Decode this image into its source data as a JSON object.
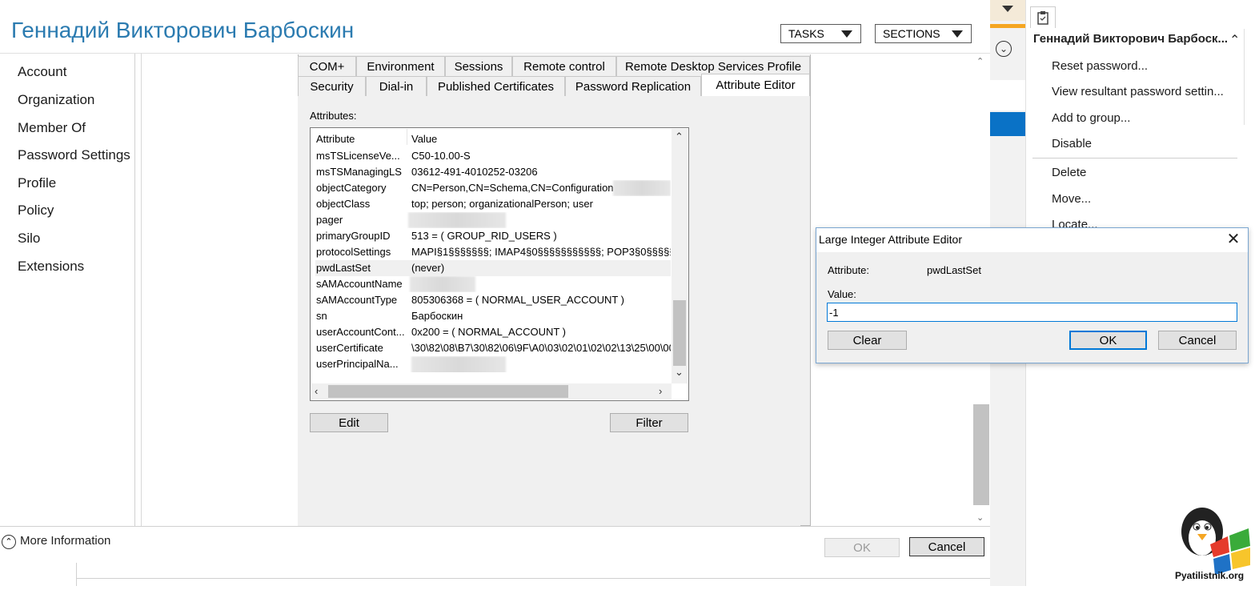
{
  "window": {
    "user_title": "Геннадий Викторович Барбоскин",
    "tasks_label": "TASKS",
    "sections_label": "SECTIONS"
  },
  "nav": {
    "items": [
      {
        "label": "Account"
      },
      {
        "label": "Organization"
      },
      {
        "label": "Member Of"
      },
      {
        "label": "Password Settings"
      },
      {
        "label": "Profile"
      },
      {
        "label": "Policy"
      },
      {
        "label": "Silo"
      },
      {
        "label": "Extensions"
      }
    ]
  },
  "properties": {
    "tabs_row1": [
      "COM+",
      "Environment",
      "Sessions",
      "Remote control",
      "Remote Desktop Services Profile"
    ],
    "tabs_row2": [
      "Security",
      "Dial-in",
      "Published Certificates",
      "Password Replication",
      "Attribute Editor"
    ],
    "active_tab": "Attribute Editor",
    "attributes_label": "Attributes:",
    "columns": {
      "attribute": "Attribute",
      "value": "Value"
    },
    "rows": [
      {
        "name": "msTSLicenseVe...",
        "value": "C50-10.00-S"
      },
      {
        "name": "msTSManagingLS",
        "value": "03612-491-4010252-03206"
      },
      {
        "name": "objectCategory",
        "value": "CN=Person,CN=Schema,CN=Configuration"
      },
      {
        "name": "objectClass",
        "value": "top; person; organizationalPerson; user"
      },
      {
        "name": "pager",
        "value": ""
      },
      {
        "name": "primaryGroupID",
        "value": "513 = ( GROUP_RID_USERS )"
      },
      {
        "name": "protocolSettings",
        "value": "MAPI§1§§§§§§§; IMAP4§0§§§§§§§§§§§; POP3§0§§§§§§"
      },
      {
        "name": "pwdLastSet",
        "value": "(never)"
      },
      {
        "name": "sAMAccountName",
        "value": ""
      },
      {
        "name": "sAMAccountType",
        "value": "805306368 = ( NORMAL_USER_ACCOUNT )"
      },
      {
        "name": "sn",
        "value": "Барбоскин"
      },
      {
        "name": "userAccountCont...",
        "value": "0x200 = ( NORMAL_ACCOUNT )"
      },
      {
        "name": "userCertificate",
        "value": "\\30\\82\\08\\B7\\30\\82\\06\\9F\\A0\\03\\02\\01\\02\\02\\13\\25\\00\\00"
      },
      {
        "name": "userPrincipalNa...",
        "value": ""
      }
    ],
    "selected_row": "pwdLastSet",
    "edit_label": "Edit",
    "filter_label": "Filter"
  },
  "bottom": {
    "more_info_label": "More Information",
    "ok_label": "OK",
    "cancel_label": "Cancel"
  },
  "tasks_pane": {
    "user_title": "Геннадий Викторович Барбоск...",
    "items": [
      {
        "label": "Reset password..."
      },
      {
        "label": "View resultant password settin..."
      },
      {
        "label": "Add to group..."
      },
      {
        "label": "Disable"
      },
      {
        "label": "Delete"
      },
      {
        "label": "Move..."
      },
      {
        "label": "Locate..."
      }
    ]
  },
  "large_integer_editor": {
    "title": "Large Integer Attribute Editor",
    "attribute_label": "Attribute:",
    "attribute_value": "pwdLastSet",
    "value_label": "Value:",
    "value": "-1",
    "clear_label": "Clear",
    "ok_label": "OK",
    "cancel_label": "Cancel"
  },
  "watermark": {
    "text": "Pyatilistnik.org"
  },
  "colors": {
    "title_blue": "#2b7bb0",
    "accent_blue": "#0078d7",
    "side_blue": "#0a72c6",
    "side_orange": "#f5a623"
  }
}
